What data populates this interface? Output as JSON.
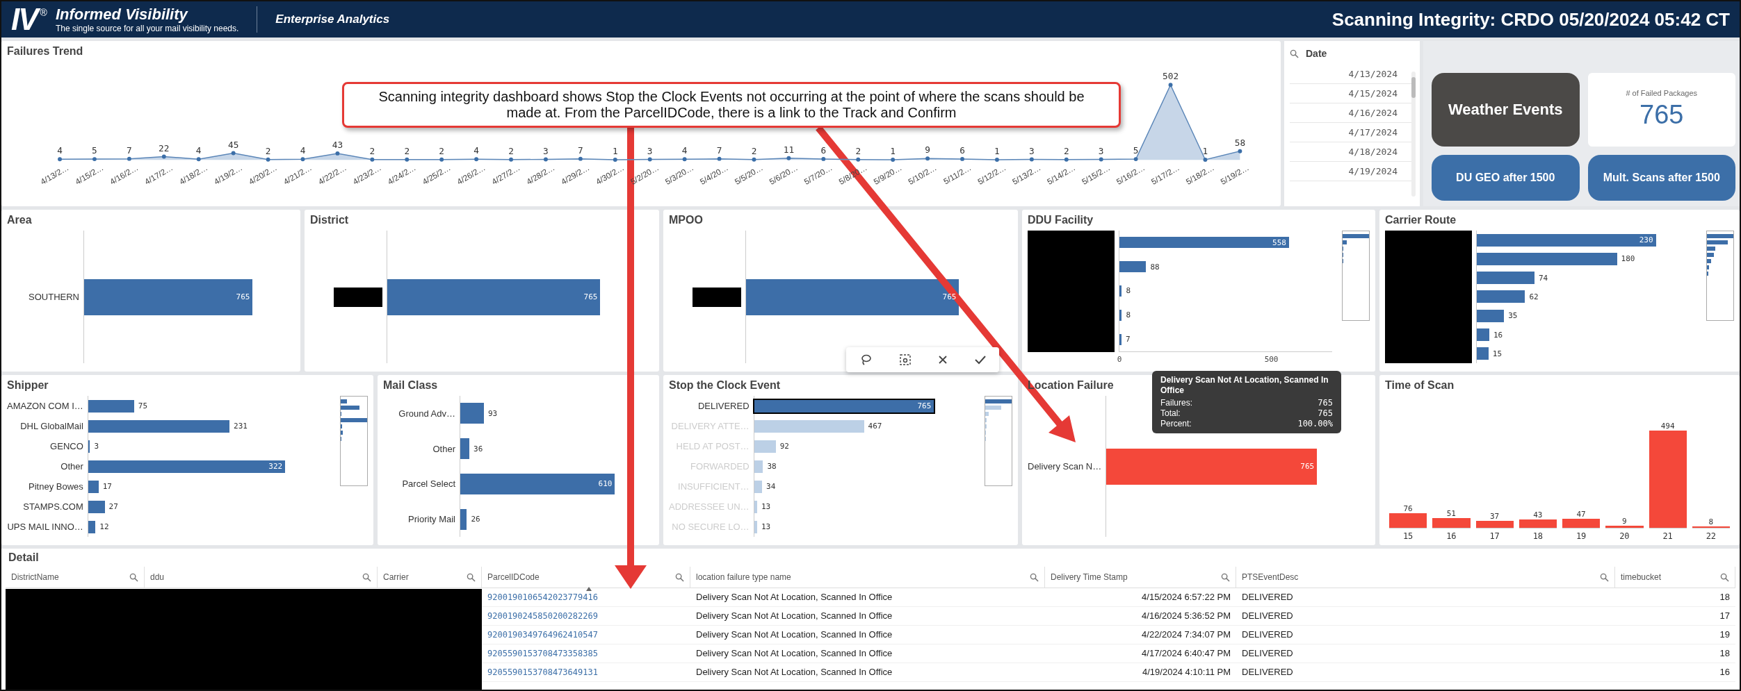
{
  "header": {
    "logo": "IV",
    "logo_mark": "®",
    "brand": "Informed Visibility",
    "tagline": "The single source for all your mail visibility needs.",
    "section": "Enterprise Analytics",
    "title": "Scanning Integrity: CRDO 05/20/2024 05:42 CT"
  },
  "failures_trend": {
    "title": "Failures Trend",
    "chart_data": {
      "type": "area",
      "data_labels": true,
      "categories": [
        "4/13/2…",
        "4/15/2…",
        "4/16/2…",
        "4/17/2…",
        "4/18/2…",
        "4/19/2…",
        "4/20/2…",
        "4/21/2…",
        "4/22/2…",
        "4/23/2…",
        "4/24/2…",
        "4/25/2…",
        "4/26/2…",
        "4/27/2…",
        "4/28/2…",
        "4/29/2…",
        "4/30/2…",
        "5/2/20…",
        "5/3/20…",
        "5/4/20…",
        "5/5/20…",
        "5/6/20…",
        "5/7/20…",
        "5/8/20…",
        "5/9/20…",
        "5/10/2…",
        "5/11/2…",
        "5/12/2…",
        "5/13/2…",
        "5/14/2…",
        "5/15/2…",
        "5/16/2…",
        "5/17/2…",
        "5/18/2…",
        "5/19/2…"
      ],
      "values": [
        4,
        5,
        7,
        22,
        4,
        45,
        2,
        4,
        43,
        2,
        2,
        2,
        4,
        2,
        3,
        7,
        1,
        3,
        4,
        7,
        2,
        11,
        6,
        2,
        1,
        9,
        6,
        1,
        3,
        2,
        3,
        5,
        502,
        1,
        58
      ]
    }
  },
  "date_filter": {
    "label": "Date",
    "items": [
      "4/13/2024",
      "4/15/2024",
      "4/16/2024",
      "4/17/2024",
      "4/18/2024",
      "4/19/2024"
    ]
  },
  "buttons": [
    {
      "label": "Weather Events",
      "kind": "dark"
    },
    {
      "label": "DU GEO after 1500",
      "kind": "blue"
    },
    {
      "label": "Mult. Scans after 1500",
      "kind": "blue"
    }
  ],
  "kpi": {
    "label": "# of Failed Packages",
    "value": "765"
  },
  "panels_row_1": [
    {
      "title": "Area",
      "kind": "bars",
      "bars": [
        {
          "label": "SOUTHERN",
          "value": "765"
        }
      ]
    },
    {
      "title": "District",
      "kind": "bars",
      "bars": [
        {
          "value": "765"
        }
      ]
    },
    {
      "title": "MPOO",
      "kind": "bars",
      "bars": [
        {
          "value": "765"
        }
      ]
    },
    {
      "title": "DDU Facility",
      "kind": "bars",
      "chart_data": {
        "type": "bar",
        "orientation": "horizontal",
        "data_labels": true,
        "categories": [
          null,
          null,
          null,
          null,
          null
        ],
        "values": [
          558,
          88,
          8,
          8,
          7
        ],
        "xlim": [
          0,
          700
        ],
        "xticks": [
          0,
          500
        ]
      }
    },
    {
      "title": "Carrier Route",
      "kind": "bars",
      "bars": [
        {
          "value": "230"
        },
        {
          "value": "180"
        },
        {
          "value": "74"
        },
        {
          "value": "62"
        },
        {
          "value": "35"
        },
        {
          "value": "16"
        },
        {
          "value": "15"
        }
      ]
    }
  ],
  "panels_row_2": [
    {
      "title": "Shipper",
      "kind": "bars",
      "chart_data": {
        "type": "bar",
        "orientation": "horizontal",
        "data_labels": true,
        "categories": [
          "AMAZON COM I…",
          "DHL GlobalMail",
          "GENCO",
          "Other",
          "Pitney Bowes",
          "STAMPS.COM",
          "UPS MAIL INNO…"
        ],
        "values": [
          75,
          231,
          3,
          322,
          17,
          27,
          12
        ]
      }
    },
    {
      "title": "Mail Class",
      "kind": "bars",
      "chart_data": {
        "type": "bar",
        "orientation": "horizontal",
        "data_labels": true,
        "categories": [
          "Ground Adv…",
          "Other",
          "Parcel Select",
          "Priority Mail"
        ],
        "values": [
          93,
          36,
          610,
          26
        ]
      }
    },
    {
      "title": "Stop the Clock Event",
      "kind": "bars",
      "chart_data": {
        "type": "bar",
        "orientation": "horizontal",
        "data_labels": true,
        "categories": [
          "DELIVERED",
          "DELIVERY ATTE…",
          "HELD AT POST…",
          "FORWARDED",
          "INSUFFICIENT…",
          "ADDRESSEE UN…",
          "NO SECURE LO…"
        ],
        "values": [
          765,
          467,
          92,
          38,
          34,
          13,
          13
        ]
      },
      "bar_states": [
        {
          "selected": true
        },
        {
          "selected": false
        },
        {
          "selected": false
        },
        {
          "selected": false
        },
        {
          "selected": false
        },
        {
          "selected": false
        },
        {
          "selected": false
        }
      ]
    },
    {
      "title": "Location Failure",
      "kind": "alert",
      "bars": [
        {
          "label": "Delivery Scan N…",
          "value": "765"
        }
      ]
    },
    {
      "title": "Time of Scan",
      "kind": "alert",
      "chart_data": {
        "type": "bar",
        "data_labels": true,
        "categories": [
          "15",
          "16",
          "17",
          "18",
          "19",
          "20",
          "21",
          "22"
        ],
        "values": [
          76,
          51,
          37,
          43,
          47,
          9,
          494,
          8
        ]
      }
    }
  ],
  "tooltip": {
    "title": "Delivery Scan Not At Location, Scanned In Office",
    "rows": [
      {
        "label": "Failures:",
        "value": "765"
      },
      {
        "label": "Total:",
        "value": "765"
      },
      {
        "label": "Percent:",
        "value": "100.00%"
      }
    ]
  },
  "detail": {
    "title": "Detail",
    "columns": [
      {
        "label": "DistrictName",
        "sorted": false
      },
      {
        "label": "ddu",
        "sorted": false
      },
      {
        "label": "Carrier",
        "sorted": false
      },
      {
        "label": "ParcelIDCode",
        "sorted": true
      },
      {
        "label": "location failure type name",
        "sorted": false
      },
      {
        "label": "Delivery Time Stamp",
        "sorted": false
      },
      {
        "label": "PTSEventDesc",
        "sorted": false
      },
      {
        "label": "timebucket",
        "sorted": false
      }
    ],
    "rows": [
      {
        "parcel": "9200190106542023779416",
        "failure": "Delivery Scan Not At Location, Scanned In Office",
        "time": "4/15/2024 6:57:22 PM",
        "event": "DELIVERED",
        "bucket": "18"
      },
      {
        "parcel": "9200190245850200282269",
        "failure": "Delivery Scan Not At Location, Scanned In Office",
        "time": "4/16/2024 5:36:52 PM",
        "event": "DELIVERED",
        "bucket": "17"
      },
      {
        "parcel": "9200190349764962410547",
        "failure": "Delivery Scan Not At Location, Scanned In Office",
        "time": "4/22/2024 7:34:07 PM",
        "event": "DELIVERED",
        "bucket": "19"
      },
      {
        "parcel": "9205590153708473358385",
        "failure": "Delivery Scan Not At Location, Scanned In Office",
        "time": "4/17/2024 6:40:47 PM",
        "event": "DELIVERED",
        "bucket": "18"
      },
      {
        "parcel": "9205590153708473649131",
        "failure": "Delivery Scan Not At Location, Scanned In Office",
        "time": "4/19/2024 4:10:11 PM",
        "event": "DELIVERED",
        "bucket": "16"
      }
    ]
  },
  "annotation": {
    "text": "Scanning integrity dashboard shows Stop the Clock Events not occurring at the point of where the scans should be made at.  From the ParcelIDCode, there is a link to the Track and Confirm"
  }
}
